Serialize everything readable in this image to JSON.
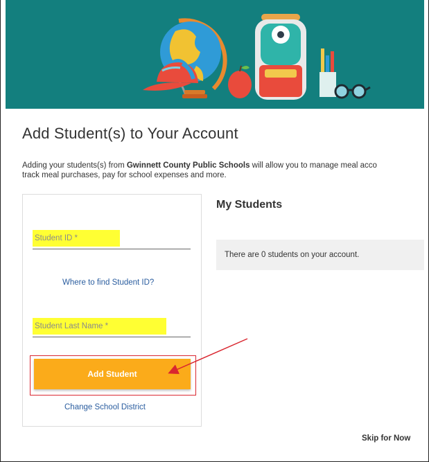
{
  "banner": {
    "illustration": "back-to-school illustration: cap, globe, apple, backpack, pencil cup, glasses"
  },
  "page": {
    "title": "Add Student(s) to Your Account",
    "intro_prefix": "Adding your students(s) from ",
    "intro_district": "Gwinnett County Public Schools",
    "intro_line1_suffix": " will allow you to manage meal acco",
    "intro_line2": "track meal purchases, pay for school expenses and more."
  },
  "form": {
    "student_id_placeholder": "Student ID *",
    "find_id_link": "Where to find Student ID?",
    "last_name_placeholder": "Student Last Name *",
    "add_button": "Add Student",
    "change_district_link": "Change School District"
  },
  "students": {
    "heading": "My Students",
    "empty_message": "There are 0 students on your account."
  },
  "footer": {
    "skip_link": "Skip for Now"
  },
  "colors": {
    "banner_bg": "#137f7e",
    "highlight": "#ffff33",
    "button_bg": "#fbab1a",
    "annotation_red": "#d9262f",
    "link": "#2a5d9f"
  }
}
